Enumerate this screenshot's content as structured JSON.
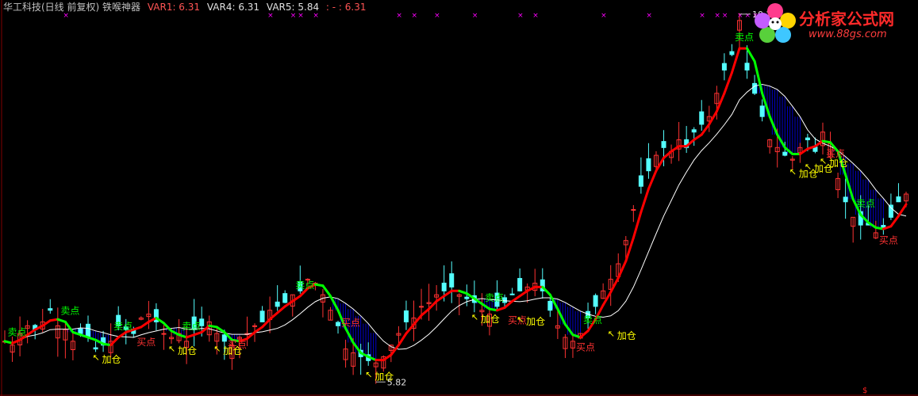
{
  "header": {
    "title": "华工科技(日线 前复权) 铁喉神器",
    "var1": "VAR1: 6.31",
    "var4": "VAR4: 6.31",
    "var5": "VAR5: 5.84",
    "var6": ": - : 6.31"
  },
  "logo": {
    "site_name": "分析家公式网",
    "url": "www.88gs.com"
  },
  "colors": {
    "up_candle": "#ff3232",
    "down_candle": "#54ffff",
    "uptrend_line": "#ff0000",
    "downtrend_line": "#00ff00",
    "slow_line": "#ffffff",
    "fill": "#0000c8",
    "sell_label": "#00ff00",
    "buy_label": "#ffff00",
    "marker": "#ff00ff"
  },
  "chart_data": {
    "type": "candlestick",
    "price_high_label": "10.24",
    "price_low_label": "5.82",
    "sell_label": "卖点",
    "buy_label": "买点",
    "add_label": "加仓",
    "marker_symbol": "×",
    "bottom_symbol": "$",
    "closes": [
      6.1,
      6.05,
      6.2,
      6.3,
      6.25,
      6.35,
      6.5,
      6.3,
      6.25,
      6.1,
      6.2,
      6.15,
      6.0,
      6.05,
      6.1,
      6.3,
      6.25,
      6.2,
      6.4,
      6.45,
      6.35,
      6.2,
      6.15,
      6.2,
      6.1,
      6.25,
      6.3,
      6.35,
      6.2,
      6.1,
      6.05,
      6.15,
      6.2,
      6.3,
      6.35,
      6.5,
      6.55,
      6.6,
      6.7,
      6.75,
      6.9,
      6.85,
      6.7,
      6.5,
      6.3,
      6.0,
      5.95,
      5.9,
      5.85,
      5.82,
      5.9,
      6.05,
      6.2,
      6.35,
      6.4,
      6.55,
      6.6,
      6.7,
      6.75,
      6.8,
      6.7,
      6.65,
      6.6,
      6.5,
      6.45,
      6.55,
      6.6,
      6.7,
      6.75,
      6.8,
      6.85,
      6.75,
      6.5,
      6.3,
      6.15,
      6.1,
      6.2,
      6.4,
      6.55,
      6.75,
      6.9,
      7.1,
      7.4,
      7.8,
      8.1,
      8.3,
      8.5,
      8.6,
      8.55,
      8.7,
      8.6,
      8.8,
      8.9,
      9.0,
      9.3,
      9.6,
      9.8,
      10.24,
      9.6,
      9.3,
      9.0,
      8.7,
      8.6,
      8.5,
      8.45,
      8.6,
      8.7,
      8.55,
      8.8,
      8.65,
      8.2,
      7.9,
      7.7,
      7.6,
      7.6,
      7.5,
      7.55,
      7.7,
      7.9,
      8.0
    ],
    "sell_points": [
      1,
      8,
      15,
      24,
      39,
      64,
      77,
      97,
      113
    ],
    "buy_points": [
      17,
      29,
      44,
      66,
      75,
      108,
      115
    ],
    "add_points": [
      12,
      22,
      28,
      48,
      62,
      68,
      80,
      104,
      106,
      108,
      123
    ]
  }
}
